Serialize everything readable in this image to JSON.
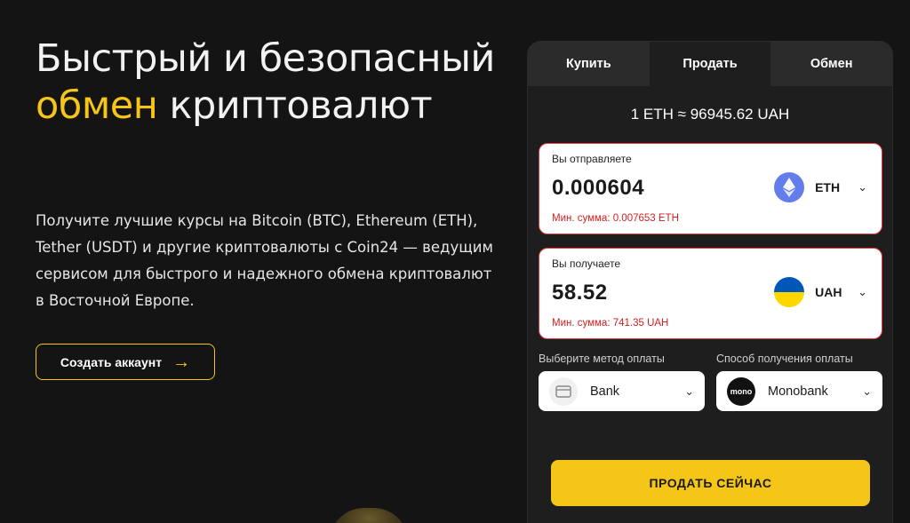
{
  "hero": {
    "title_part1": "Быстрый и безопасный ",
    "title_accent": "обмен",
    "title_part2": " криптовалют",
    "description": "Получите лучшие курсы на Bitcoin (BTC), Ethereum (ETH), Tether (USDT) и другие криптовалюты с Coin24 — ведущим сервисом для быстрого и надежного обмена криптовалют в Восточной Европе.",
    "cta_label": "Создать аккаунт",
    "cta_icon": "arrow-right-icon"
  },
  "colors": {
    "background": "#141414",
    "accent": "#f5c518",
    "panel": "#1e1e1e",
    "error": "#d11f1f"
  },
  "widget": {
    "tabs": [
      {
        "label": "Купить",
        "active": false
      },
      {
        "label": "Продать",
        "active": true
      },
      {
        "label": "Обмен",
        "active": false
      }
    ],
    "rate": "1 ETH ≈ 96945.62 UAH",
    "send": {
      "label": "Вы отправляете",
      "amount": "0.000604",
      "currency": "ETH",
      "currency_icon": "ethereum-icon",
      "min_note": "Мин. сумма: 0.007653 ETH"
    },
    "receive": {
      "label": "Вы получаете",
      "amount": "58.52",
      "currency": "UAH",
      "currency_icon": "ukraine-flag-icon",
      "min_note": "Мин. сумма: 741.35 UAH"
    },
    "payment_method": {
      "label": "Выберите метод оплаты",
      "value": "Bank",
      "icon": "credit-card-icon"
    },
    "payout_method": {
      "label": "Способ получения оплаты",
      "value": "Monobank",
      "icon": "monobank-logo",
      "logo_text": "mono"
    },
    "submit_label": "ПРОДАТЬ СЕЙЧАС"
  }
}
